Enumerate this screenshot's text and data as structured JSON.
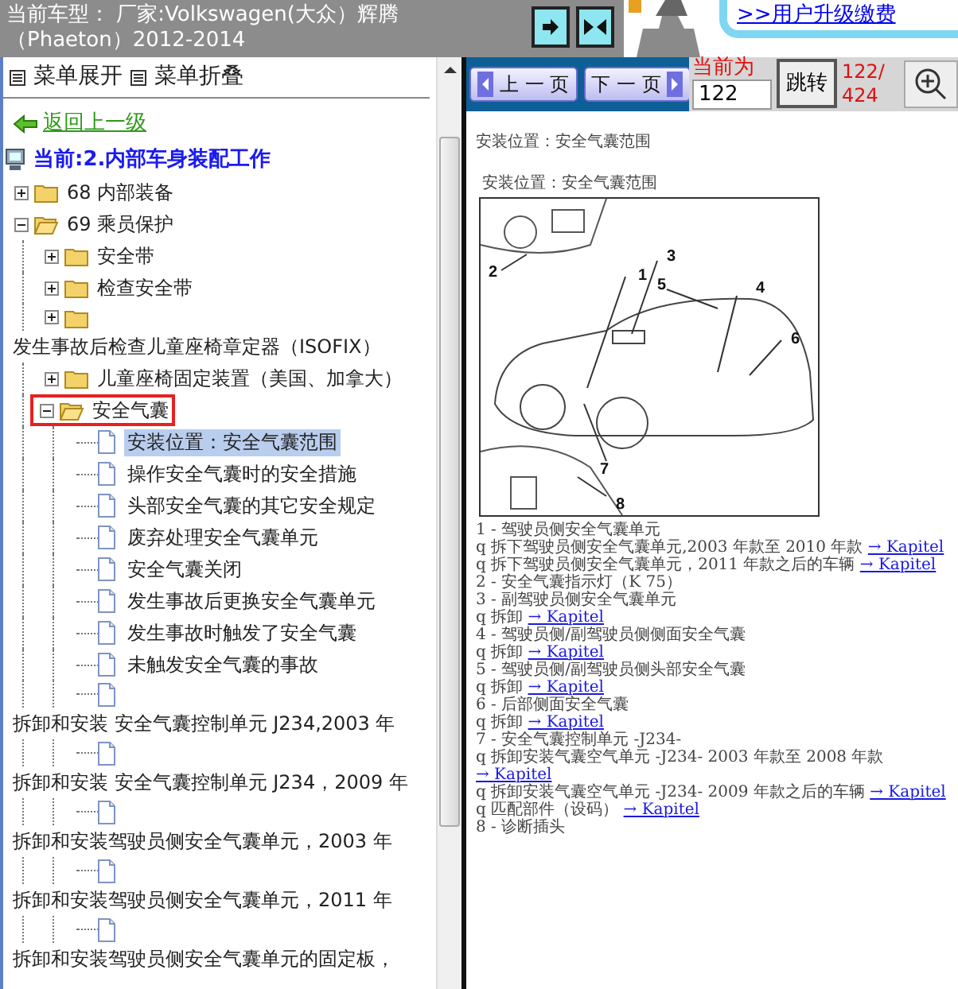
{
  "header": {
    "car_model": "当前车型： 厂家:Volkswagen(大众）辉腾",
    "car_model_line2": "（Phaeton）2012-2014",
    "upgrade_link": ">>用户升级缴费"
  },
  "menu": {
    "expand": "菜单展开",
    "collapse": "菜单折叠"
  },
  "back_link": "返回上一级",
  "tree": {
    "label": "当前:2.内部车身装配工作",
    "children": [
      {
        "kind": "folder",
        "label": "68 内部装备",
        "expanded": false,
        "selected": false
      },
      {
        "kind": "folder",
        "label": "69 乘员保护",
        "expanded": true,
        "selected": false,
        "children": [
          {
            "kind": "folder",
            "label": "安全带",
            "expanded": false,
            "selected": false
          },
          {
            "kind": "folder",
            "label": "检查安全带",
            "expanded": false,
            "selected": false
          },
          {
            "kind": "folder",
            "label": "发生事故后检查儿童座椅章定器（ISOFIX）",
            "wrap": true,
            "expanded": false,
            "selected": false
          },
          {
            "kind": "folder",
            "label": "儿童座椅固定装置（美国、加拿大）",
            "expanded": false,
            "selected": false
          },
          {
            "kind": "folder",
            "label": "安全气囊",
            "expanded": true,
            "marked": true,
            "selected": false,
            "children": [
              {
                "kind": "page",
                "label": "安装位置：安全气囊范围",
                "selected": true
              },
              {
                "kind": "page",
                "label": "操作安全气囊时的安全措施",
                "selected": false
              },
              {
                "kind": "page",
                "label": "头部安全气囊的其它安全规定",
                "selected": false
              },
              {
                "kind": "page",
                "label": "废弃处理安全气囊单元",
                "selected": false
              },
              {
                "kind": "page",
                "label": "安全气囊关闭",
                "selected": false
              },
              {
                "kind": "page",
                "label": "发生事故后更换安全气囊单元",
                "selected": false
              },
              {
                "kind": "page",
                "label": "发生事故时触发了安全气囊",
                "selected": false
              },
              {
                "kind": "page",
                "label": "未触发安全气囊的事故",
                "selected": false
              },
              {
                "kind": "page",
                "label": "拆卸和安装 安全气囊控制单元 J234,2003 年",
                "wrap": true,
                "selected": false
              },
              {
                "kind": "page",
                "label": "拆卸和安装 安全气囊控制单元 J234，2009 年",
                "wrap": true,
                "selected": false
              },
              {
                "kind": "page",
                "label": "拆卸和安装驾驶员侧安全气囊单元，2003 年",
                "wrap": true,
                "selected": false
              },
              {
                "kind": "page",
                "label": "拆卸和安装驾驶员侧安全气囊单元，2011 年",
                "wrap": true,
                "selected": false
              },
              {
                "kind": "page",
                "label": "拆卸和安装驾驶员侧安全气囊单元的固定板，",
                "wrap": true,
                "selected": false
              }
            ]
          }
        ]
      }
    ]
  },
  "viewer": {
    "prev": "上 一 页",
    "next": "下 一 页",
    "current_label": "当前为",
    "page_input": "122",
    "go": "跳转",
    "page_count": "122/424"
  },
  "document": {
    "heading": "安装位置：安全气囊范围",
    "figure_caption": "安装位置：安全气囊范围",
    "callouts": [
      "1",
      "2",
      "3",
      "4",
      "5",
      "6",
      "7",
      "8"
    ],
    "lines": [
      {
        "text": "1 - 驾驶员侧安全气囊单元"
      },
      {
        "text": "q  拆下驾驶员侧安全气囊单元,2003 年款至 2010 年款",
        "link": "→ Kapitel"
      },
      {
        "text": "q  拆下驾驶员侧安全气囊单元，2011 年款之后的车辆",
        "link": "→ Kapitel"
      },
      {
        "text": "2 - 安全气囊指示灯（K 75）"
      },
      {
        "text": "3 - 副驾驶员侧安全气囊单元"
      },
      {
        "text": "q  拆卸",
        "link": "→ Kapitel"
      },
      {
        "text": "4 - 驾驶员侧/副驾驶员侧侧面安全气囊"
      },
      {
        "text": "q  拆卸",
        "link": "→ Kapitel"
      },
      {
        "text": "5 - 驾驶员侧/副驾驶员侧头部安全气囊"
      },
      {
        "text": "q  拆卸",
        "link": "→ Kapitel"
      },
      {
        "text": "6 - 后部侧面安全气囊"
      },
      {
        "text": "q  拆卸",
        "link": "→ Kapitel"
      },
      {
        "text": "7 - 安全气囊控制单元 -J234-"
      },
      {
        "text": "q  拆卸安装气囊空气单元 -J234- 2003 年款至 2008 年款",
        "link": "→ Kapitel"
      },
      {
        "text": "q  拆卸安装气囊空气单元 -J234- 2009 年款之后的车辆",
        "link": "→ Kapitel"
      },
      {
        "text": "q  匹配部件（设码）",
        "link": "→ Kapitel"
      },
      {
        "text": "8 - 诊断插头"
      }
    ]
  }
}
